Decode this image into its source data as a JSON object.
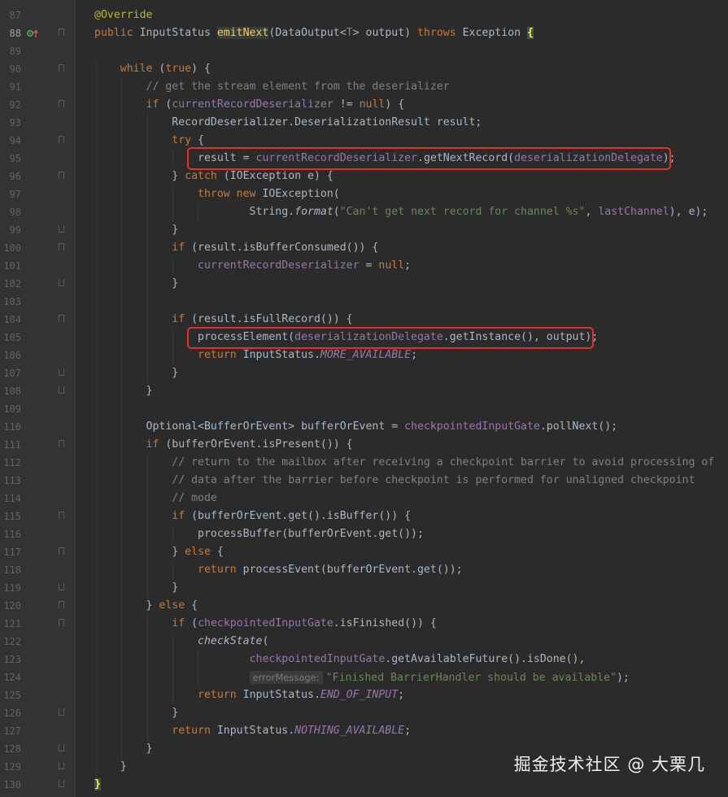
{
  "editor": {
    "lines": [
      {
        "num": "87",
        "html": "<span class=\"ann\">@Override</span>"
      },
      {
        "num": "88",
        "html": "<span class=\"kw\">public</span> InputStatus <span class=\"hl-name\">emitNext</span>(DataOutput&lt;<span class=\"cm\">T</span>&gt; output) <span class=\"kw\">throws</span> Exception <span class=\"brace-hl\">{</span>"
      },
      {
        "num": "89",
        "html": ""
      },
      {
        "num": "90",
        "html": "    <span class=\"kw\">while</span> (<span class=\"kw\">true</span>) {"
      },
      {
        "num": "91",
        "html": "        <span class=\"cm\">// get the stream element from the deserializer</span>"
      },
      {
        "num": "92",
        "html": "        <span class=\"kw\">if</span> (<span class=\"fld\">currentRecordDeserializer</span> != <span class=\"kw\">null</span>) {"
      },
      {
        "num": "93",
        "html": "            RecordDeserializer.DeserializationResult result;"
      },
      {
        "num": "94",
        "html": "            <span class=\"kw\">try</span> {"
      },
      {
        "num": "95",
        "html": "                result = <span class=\"fld\">currentRecordDeserializer</span>.getNextRecord(<span class=\"fld\">deserializationDelegate</span>);"
      },
      {
        "num": "96",
        "html": "            } <span class=\"kw\">catch</span> (IOException e) {"
      },
      {
        "num": "97",
        "html": "                <span class=\"kw\">throw new</span> IOException("
      },
      {
        "num": "98",
        "html": "                        String.<span class=\"smeth\">format</span>(<span class=\"str\">\"Can't get next record for channel %s\"</span>, <span class=\"fld\">lastChannel</span>), e);"
      },
      {
        "num": "99",
        "html": "            }"
      },
      {
        "num": "100",
        "html": "            <span class=\"kw\">if</span> (result.isBufferConsumed()) {"
      },
      {
        "num": "101",
        "html": "                <span class=\"fld\">currentRecordDeserializer</span> = <span class=\"kw\">null</span>;"
      },
      {
        "num": "102",
        "html": "            }"
      },
      {
        "num": "103",
        "html": ""
      },
      {
        "num": "104",
        "html": "            <span class=\"kw\">if</span> (result.isFullRecord()) {"
      },
      {
        "num": "105",
        "html": "                processElement(<span class=\"fld\">deserializationDelegate</span>.getInstance(), output);"
      },
      {
        "num": "106",
        "html": "                <span class=\"kw\">return</span> InputStatus.<span class=\"sit\">MORE_AVAILABLE</span>;"
      },
      {
        "num": "107",
        "html": "            }"
      },
      {
        "num": "108",
        "html": "        }"
      },
      {
        "num": "109",
        "html": ""
      },
      {
        "num": "110",
        "html": "        Optional&lt;BufferOrEvent&gt; bufferOrEvent = <span class=\"fld\">checkpointedInputGate</span>.pollNext();"
      },
      {
        "num": "111",
        "html": "        <span class=\"kw\">if</span> (bufferOrEvent.isPresent()) {"
      },
      {
        "num": "112",
        "html": "            <span class=\"cm\">// return to the mailbox after receiving a checkpoint barrier to avoid processing of</span>"
      },
      {
        "num": "113",
        "html": "            <span class=\"cm\">// data after the barrier before checkpoint is performed for unaligned checkpoint</span>"
      },
      {
        "num": "114",
        "html": "            <span class=\"cm\">// mode</span>"
      },
      {
        "num": "115",
        "html": "            <span class=\"kw\">if</span> (bufferOrEvent.get().isBuffer()) {"
      },
      {
        "num": "116",
        "html": "                processBuffer(bufferOrEvent.get());"
      },
      {
        "num": "117",
        "html": "            } <span class=\"kw\">else</span> {"
      },
      {
        "num": "118",
        "html": "                <span class=\"kw\">return</span> processEvent(bufferOrEvent.get());"
      },
      {
        "num": "119",
        "html": "            }"
      },
      {
        "num": "120",
        "html": "        } <span class=\"kw\">else</span> {"
      },
      {
        "num": "121",
        "html": "            <span class=\"kw\">if</span> (<span class=\"fld\">checkpointedInputGate</span>.isFinished()) {"
      },
      {
        "num": "122",
        "html": "                <span class=\"smeth\">checkState</span>("
      },
      {
        "num": "123",
        "html": "                        <span class=\"fld\">checkpointedInputGate</span>.getAvailableFuture().isDone(),"
      },
      {
        "num": "124",
        "html": "                        <span class=\"hint\">errorMessage:</span><span class=\"str\">\"Finished BarrierHandler should be available\"</span>);"
      },
      {
        "num": "125",
        "html": "                <span class=\"kw\">return</span> InputStatus.<span class=\"sit\">END_OF_INPUT</span>;"
      },
      {
        "num": "126",
        "html": "            }"
      },
      {
        "num": "127",
        "html": "            <span class=\"kw\">return</span> InputStatus.<span class=\"sit\">NOTHING_AVAILABLE</span>;"
      },
      {
        "num": "128",
        "html": "        }"
      },
      {
        "num": "129",
        "html": "    }"
      },
      {
        "num": "130",
        "html": "<span class=\"brace-hl\">}</span>"
      }
    ]
  },
  "watermark": {
    "text": "掘金技术社区 @ 大栗几"
  },
  "colors": {
    "background": "#2b2b2b",
    "keyword": "#cc7832",
    "field": "#9876aa",
    "string": "#6a8759",
    "comment": "#808080",
    "annotation": "#bbb529",
    "highlight_box": "#e5302a"
  },
  "icons": {
    "gutter_marker": "override-implements-icon"
  }
}
